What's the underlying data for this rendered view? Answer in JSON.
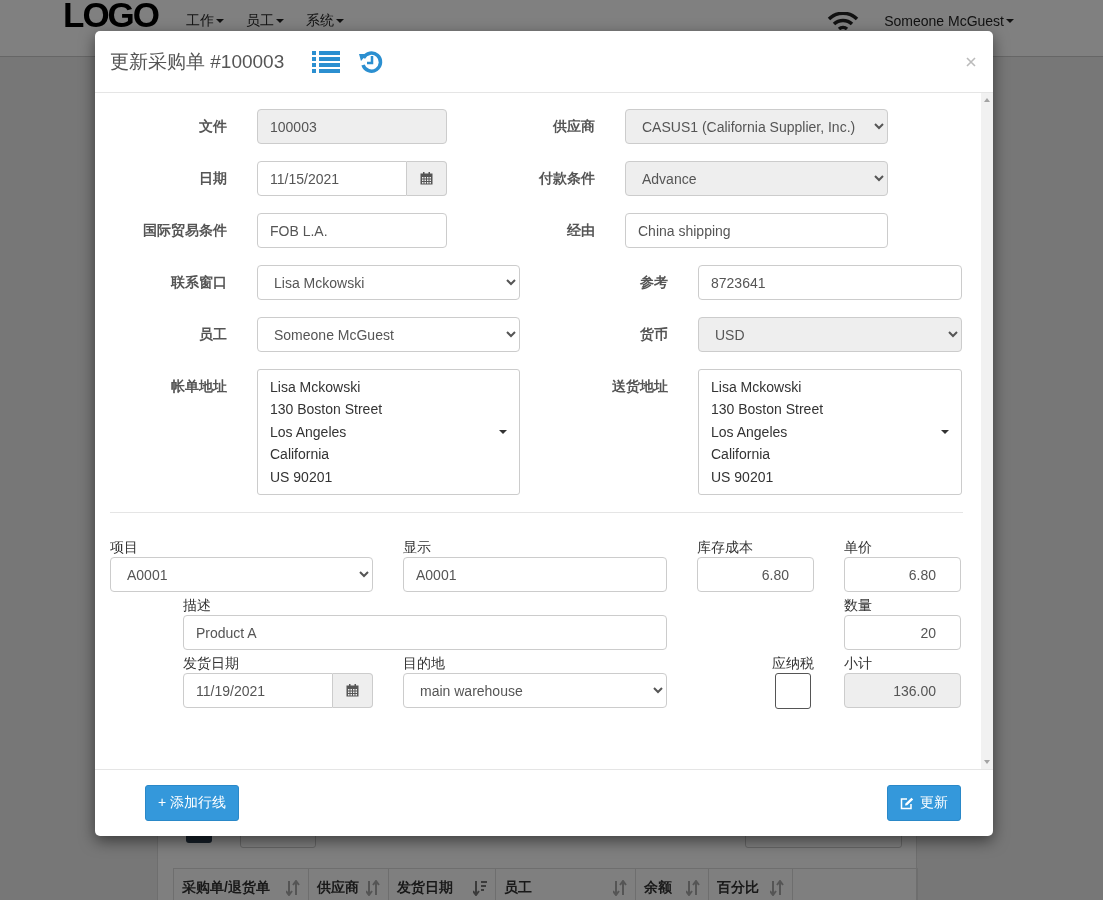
{
  "navbar": {
    "logo": "LOGO",
    "menus": [
      {
        "label": "工作"
      },
      {
        "label": "员工"
      },
      {
        "label": "系统"
      }
    ],
    "user": "Someone McGuest"
  },
  "background_table": {
    "columns": [
      {
        "label": "采购单/退货单",
        "sorted": false
      },
      {
        "label": "供应商",
        "sorted": false
      },
      {
        "label": "发货日期",
        "sorted": true
      },
      {
        "label": "员工",
        "sorted": false
      },
      {
        "label": "余额",
        "sorted": false
      },
      {
        "label": "百分比",
        "sorted": false
      }
    ]
  },
  "modal": {
    "title": "更新采购单 #100003",
    "rows": [
      {
        "left": {
          "label": "文件",
          "kind": "text",
          "value": "100003",
          "disabled": true
        },
        "right": {
          "label": "供应商",
          "kind": "select",
          "value": "CASUS1 (California Supplier, Inc.)",
          "disabled": true
        }
      },
      {
        "left": {
          "label": "日期",
          "kind": "date",
          "value": "11/15/2021",
          "disabled": false
        },
        "right": {
          "label": "付款条件",
          "kind": "select",
          "value": "Advance",
          "disabled": true
        }
      },
      {
        "left": {
          "label": "国际贸易条件",
          "kind": "text",
          "value": "FOB L.A.",
          "disabled": false
        },
        "right": {
          "label": "经由",
          "kind": "text",
          "value": "China shipping",
          "disabled": false
        }
      },
      {
        "left": {
          "label": "联系窗口",
          "kind": "select",
          "value": "Lisa Mckowski",
          "disabled": false
        },
        "right": {
          "label": "参考",
          "kind": "text",
          "value": "8723641",
          "disabled": false
        }
      },
      {
        "left": {
          "label": "员工",
          "kind": "select",
          "value": "Someone McGuest",
          "disabled": false
        },
        "right": {
          "label": "货币",
          "kind": "select",
          "value": "USD",
          "disabled": true
        }
      },
      {
        "left": {
          "label": "帐单地址",
          "kind": "address",
          "lines": [
            "Lisa Mckowski",
            "130 Boston Street",
            "Los Angeles",
            "California",
            "US 90201"
          ],
          "disabled": false
        },
        "right": {
          "label": "送货地址",
          "kind": "address",
          "lines": [
            "Lisa Mckowski",
            "130 Boston Street",
            "Los Angeles",
            "California",
            "US 90201"
          ],
          "disabled": false
        }
      }
    ],
    "line_item": {
      "fields": [
        {
          "label": "项目",
          "kind": "select",
          "value": "A0001",
          "disabled": false
        },
        {
          "label": "显示",
          "kind": "text",
          "value": "A0001",
          "disabled": false
        },
        {
          "label": "库存成本",
          "kind": "number",
          "value": "6.80",
          "disabled": false
        },
        {
          "label": "单价",
          "kind": "number",
          "value": "6.80",
          "disabled": false
        },
        {
          "label": "描述",
          "kind": "text",
          "value": "Product A",
          "disabled": false
        },
        {
          "label": "数量",
          "kind": "number",
          "value": "20",
          "disabled": false
        },
        {
          "label": "发货日期",
          "kind": "date",
          "value": "11/19/2021",
          "disabled": false
        },
        {
          "label": "目的地",
          "kind": "select",
          "value": "main warehouse",
          "disabled": false
        },
        {
          "label": "应纳税",
          "kind": "checkbox",
          "checked": false,
          "disabled": false
        },
        {
          "label": "小计",
          "kind": "number",
          "value": "136.00",
          "disabled": true
        }
      ]
    },
    "buttons": [
      {
        "kind": "add",
        "label": "+ 添加行线"
      },
      {
        "kind": "update",
        "label": "更新"
      }
    ]
  }
}
